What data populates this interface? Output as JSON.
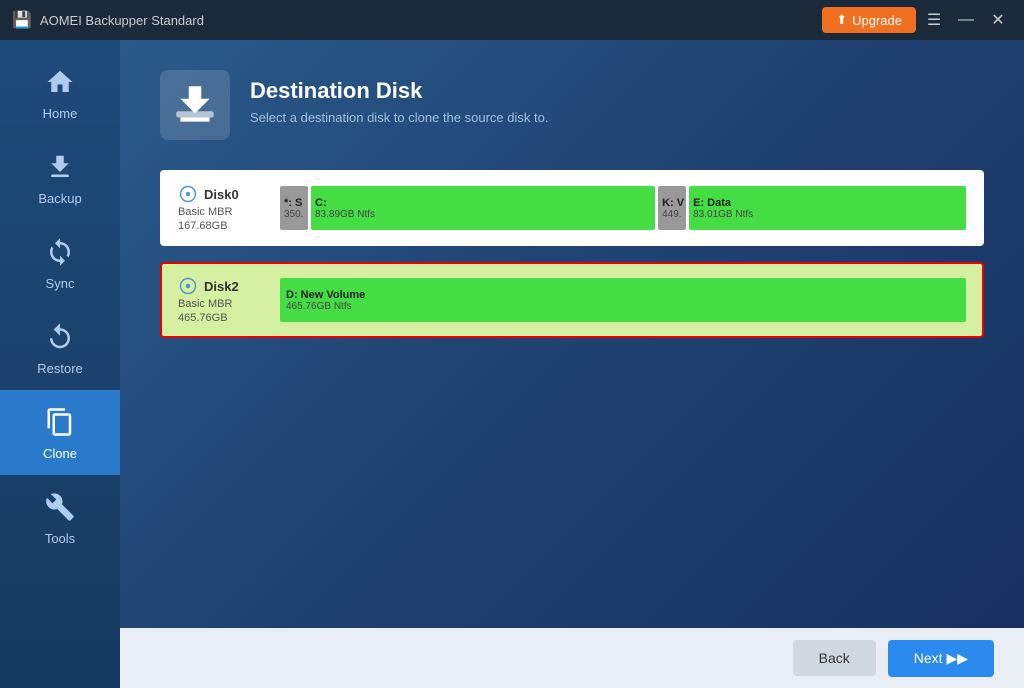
{
  "app": {
    "title": "AOMEI Backupper Standard",
    "upgrade_label": "Upgrade"
  },
  "titlebar_controls": {
    "menu": "☰",
    "minimize": "—",
    "close": "✕"
  },
  "sidebar": {
    "items": [
      {
        "id": "home",
        "label": "Home",
        "active": false
      },
      {
        "id": "backup",
        "label": "Backup",
        "active": false
      },
      {
        "id": "sync",
        "label": "Sync",
        "active": false
      },
      {
        "id": "restore",
        "label": "Restore",
        "active": false
      },
      {
        "id": "clone",
        "label": "Clone",
        "active": true
      },
      {
        "id": "tools",
        "label": "Tools",
        "active": false
      }
    ]
  },
  "page": {
    "title": "Destination Disk",
    "subtitle": "Select a destination disk to clone the source disk to."
  },
  "disks": [
    {
      "id": "disk0",
      "name": "Disk0",
      "type": "Basic MBR",
      "size": "167.68GB",
      "selected": false,
      "partitions": [
        {
          "id": "sys",
          "label": "*: S",
          "extra": "350.",
          "bar_color": "#aaa",
          "width": "small"
        },
        {
          "id": "c",
          "label": "C:",
          "size": "83.89GB Ntfs",
          "bar_color": "#44dd44",
          "width": "large"
        },
        {
          "id": "k",
          "label": "K: V",
          "extra": "449.",
          "bar_color": "#aaa",
          "width": "small"
        },
        {
          "id": "e",
          "label": "E: Data",
          "size": "83.01GB Ntfs",
          "bar_color": "#44dd44",
          "width": "large"
        }
      ]
    },
    {
      "id": "disk2",
      "name": "Disk2",
      "type": "Basic MBR",
      "size": "465.76GB",
      "selected": true,
      "partitions": [
        {
          "id": "d",
          "label": "D: New Volume",
          "size": "465.76GB Ntfs",
          "bar_color": "#44dd44",
          "width": "full"
        }
      ]
    }
  ],
  "buttons": {
    "back": "Back",
    "next": "Next %%"
  }
}
